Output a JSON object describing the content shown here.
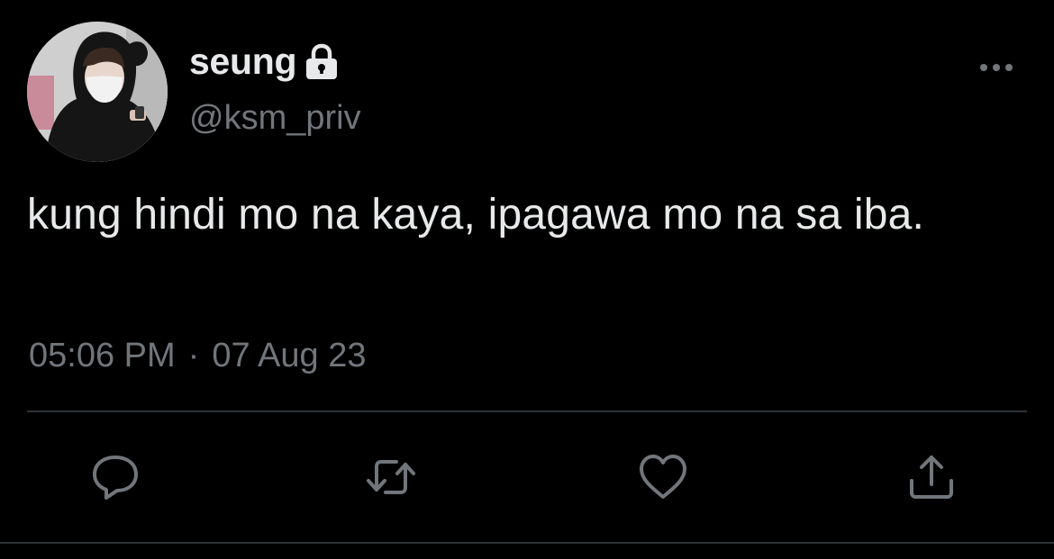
{
  "tweet": {
    "author": {
      "display_name": "seung",
      "handle": "@ksm_priv",
      "protected_icon": "lock-icon",
      "avatar": "profile-photo"
    },
    "text": "kung hindi mo na kaya, ipagawa mo na sa iba.",
    "time": "05:06 PM",
    "separator": "·",
    "date": "07 Aug 23"
  },
  "actions": [
    {
      "name": "reply",
      "icon": "speech-bubble-icon"
    },
    {
      "name": "retweet",
      "icon": "retweet-arrows-icon"
    },
    {
      "name": "like",
      "icon": "heart-icon"
    },
    {
      "name": "share",
      "icon": "share-upload-icon"
    }
  ],
  "menu": {
    "icon": "more-options-icon"
  },
  "colors": {
    "background": "#000000",
    "primary_text": "#e7e9ea",
    "secondary_text": "#71767b",
    "divider": "#2f3336"
  }
}
